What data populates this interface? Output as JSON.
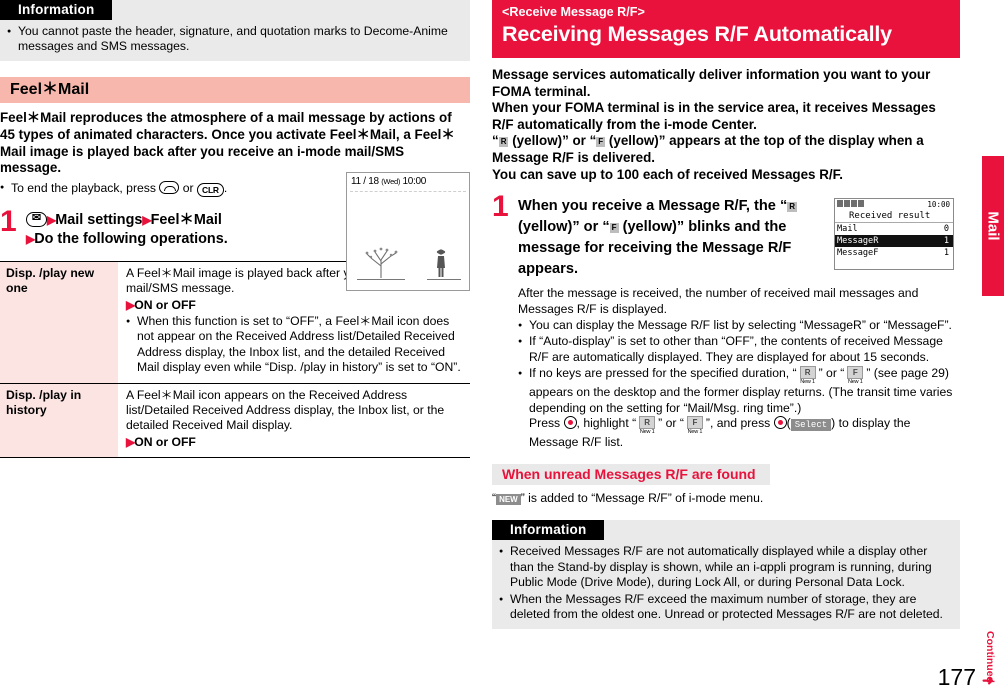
{
  "left": {
    "information": {
      "header": "Information",
      "items": [
        "You cannot paste the header, signature, and quotation marks to Decome-Anime messages and SMS messages."
      ]
    },
    "section": {
      "title": "Feel＊Mail",
      "body": "Feel＊Mail reproduces the atmosphere of a mail message by actions of 45 types of animated characters. Once you activate Feel＊Mail, a Feel＊Mail image is played back after you receive an i-mode mail/SMS message.",
      "bullet_pre": "To end the playback, press",
      "bullet_mid": "or",
      "bullet_end": ".",
      "key_clr": "CLR"
    },
    "phone_screen": {
      "date": "11 / 18",
      "day": "(Wed)",
      "time": "10:00"
    },
    "step": {
      "number": "1",
      "line1_a": "Mail settings",
      "line1_b": "Feel＊Mail",
      "line2": "Do the following operations."
    },
    "table": {
      "rows": [
        {
          "key": "Disp. /play new one",
          "desc": "A Feel＊Mail image is played back after you receive an i-mode mail/SMS message.",
          "onoff": "ON or OFF",
          "note": "When this function is set to “OFF”, a Feel＊Mail icon does not appear on the Received Address list/Detailed Received Address display, the Inbox list, and the detailed Received Mail display even while “Disp. /play in history” is set to “ON”."
        },
        {
          "key": "Disp. /play in history",
          "desc": "A Feel＊Mail icon appears on the Received Address list/Detailed Received Address display, the Inbox list, or the detailed Received Mail display.",
          "onoff": "ON or OFF",
          "note": ""
        }
      ]
    }
  },
  "right": {
    "title": {
      "sub": "<Receive Message R/F>",
      "main": "Receiving Messages R/F Automatically"
    },
    "intro": {
      "l1": "Message services automatically deliver information you want to your FOMA terminal.",
      "l2": "When your FOMA terminal is in the service area, it receives Messages R/F automatically from the i-mode Center.",
      "l3_a": "“",
      "l3_icon1": "R",
      "l3_b": "(yellow)” or “",
      "l3_icon2": "F",
      "l3_c": "(yellow)” appears at the top of the display when a Message R/F is delivered.",
      "l4": "You can save up to 100 each of received Messages R/F."
    },
    "step": {
      "number": "1",
      "head_a": "When you receive a Message R/F, the “",
      "head_icon1": "R",
      "head_b": "(yellow)” or “",
      "head_icon2": "F",
      "head_c": "(yellow)” blinks and the message for receiving the Message R/F appears.",
      "body_intro": "After the message is received, the number of received mail messages and Messages R/F is displayed.",
      "bullets": [
        "You can display the Message R/F list by selecting “MessageR” or “MessageF”.",
        "If “Auto-display” is set to other than “OFF”, the contents of received Message R/F are automatically displayed. They are displayed for about 15 seconds."
      ],
      "bullet3_a": "If no keys are pressed for the specified duration, “",
      "bullet3_b": "” or “",
      "bullet3_c": "” (see page 29) appears on the desktop and the former display returns. (The transit time varies depending on the setting for “Mail/Msg. ring time”.)",
      "press_a": "Press",
      "press_b": ", highlight “",
      "press_c": "” or “",
      "press_d": "”, and press",
      "press_e": ") to display the Message R/F list.",
      "select_label": "Select",
      "icon_new_label": "New 1",
      "icon_r": "R",
      "icon_f": "F"
    },
    "phone_screen": {
      "time": "10:00",
      "title": "Received result",
      "rows": [
        {
          "icon": "",
          "label": "Mail",
          "count": "0",
          "selected": false
        },
        {
          "icon": "R",
          "label": "MessageR",
          "count": "1",
          "selected": true
        },
        {
          "icon": "F",
          "label": "MessageF",
          "count": "1",
          "selected": false
        }
      ]
    },
    "subsection": {
      "heading": "When unread Messages R/F are found",
      "text_a": "“",
      "icon": "NEW",
      "text_b": "” is added to “Message R/F” of i-mode menu."
    },
    "information": {
      "header": "Information",
      "items": [
        "Received Messages R/F are not automatically displayed while a display other than the Stand-by display is shown, while an i-αppli program is running, during Public Mode (Drive Mode), during Lock All, or during Personal Data Lock.",
        "When the Messages R/F exceed the maximum number of storage, they are deleted from the oldest one. Unread or protected Messages R/F are not deleted."
      ]
    }
  },
  "side_tab": {
    "label": "Mail"
  },
  "footer": {
    "page": "177",
    "continued": "Continued",
    "arrow": "➜"
  }
}
